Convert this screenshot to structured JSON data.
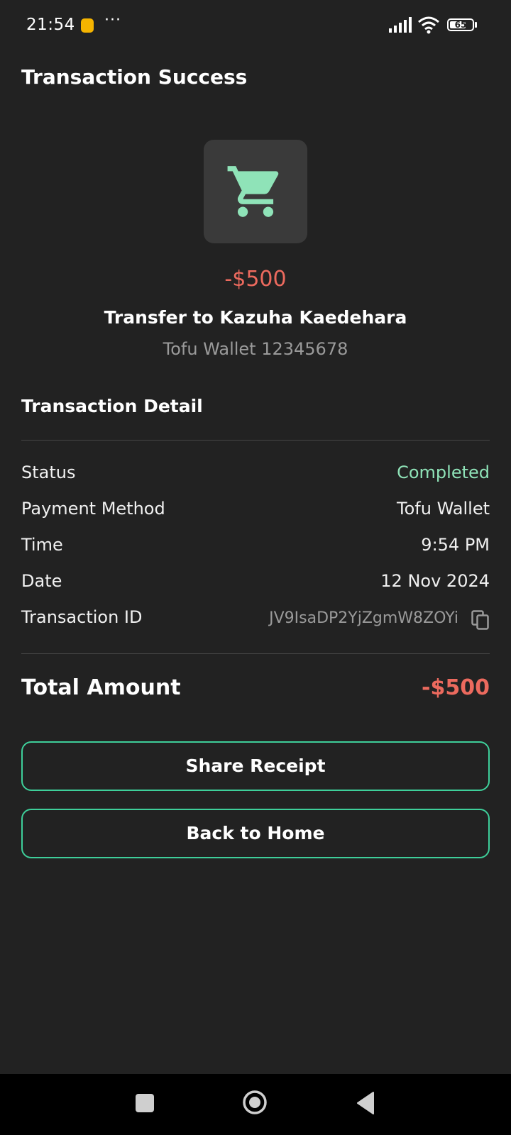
{
  "status_bar": {
    "time": "21:54",
    "dots": "···",
    "battery": "65",
    "icons": [
      "app-notification-icon",
      "signal-icon",
      "wifi-icon",
      "battery-icon"
    ]
  },
  "header": {
    "title": "Transaction Success"
  },
  "hero": {
    "icon": "shopping-cart-icon",
    "amount": "-$500",
    "title": "Transfer to Kazuha Kaedehara",
    "subtitle": "Tofu Wallet 12345678"
  },
  "detail": {
    "section_title": "Transaction Detail",
    "rows": [
      {
        "label": "Status",
        "value": "Completed"
      },
      {
        "label": "Payment Method",
        "value": "Tofu Wallet"
      },
      {
        "label": "Time",
        "value": "9:54 PM"
      },
      {
        "label": "Date",
        "value": "12 Nov 2024"
      },
      {
        "label": "Transaction ID",
        "value": "JV9IsaDP2YjZgmW8ZOYi"
      }
    ]
  },
  "total": {
    "label": "Total Amount",
    "value": "-$500"
  },
  "actions": {
    "share_label": "Share Receipt",
    "home_label": "Back to Home"
  },
  "colors": {
    "background": "#222222",
    "negative": "#ec6a5e",
    "success": "#8fe3b8",
    "button_border": "#3ecf9a"
  }
}
